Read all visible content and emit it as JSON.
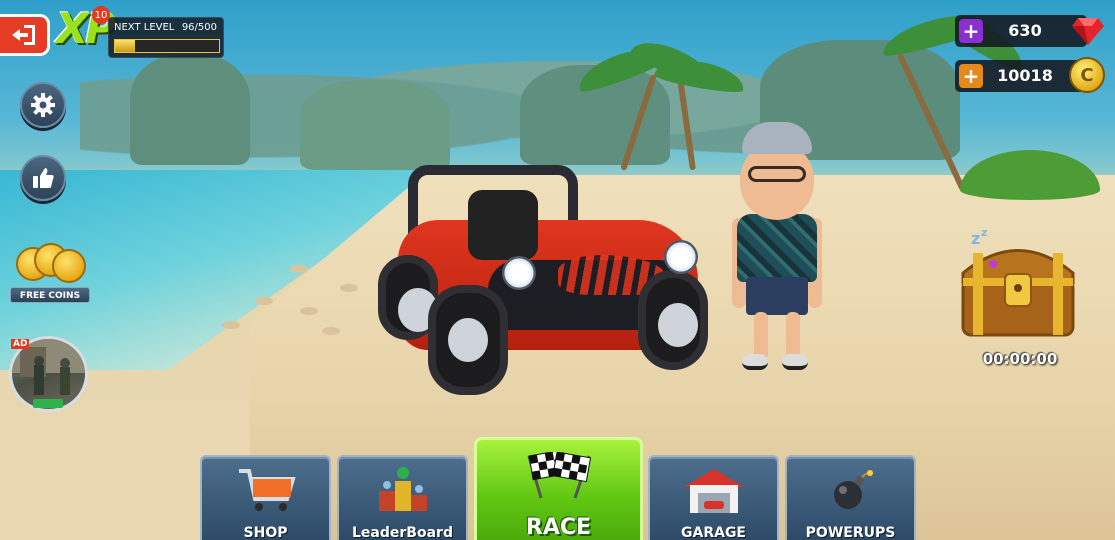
{
  "hud": {
    "xp_logo": "XP",
    "xp_level": "10",
    "next_level_label": "NEXT LEVEL",
    "xp_progress_text": "96/500",
    "xp_progress_fraction": 0.192,
    "free_coins_label": "FREE COINS",
    "ad_label": "AD",
    "chest_timer": "00:00:00"
  },
  "currency": {
    "gems": "630",
    "coins": "10018",
    "coin_symbol": "C"
  },
  "menu": {
    "shop": "SHOP",
    "leaderboard": "LeaderBoard",
    "race": "RACE",
    "garage": "GARAGE",
    "powerups": "POWERUPS"
  },
  "colors": {
    "race_green": "#61c712",
    "menu_blue": "#2c4a66",
    "back_red": "#e63c26",
    "gem_plus": "#8a2fd1",
    "coin_plus": "#e48a1d"
  },
  "icons": {
    "back": "exit-arrow-icon",
    "settings": "gear-icon",
    "like": "thumbs-up-icon",
    "gem": "ruby-gem-icon",
    "coin": "gold-coin-icon",
    "chest": "treasure-chest-icon",
    "shop": "shopping-cart-icon",
    "leaderboard": "podium-icon",
    "race": "checkered-flags-icon",
    "garage": "garage-icon",
    "powerups": "bomb-icon"
  }
}
